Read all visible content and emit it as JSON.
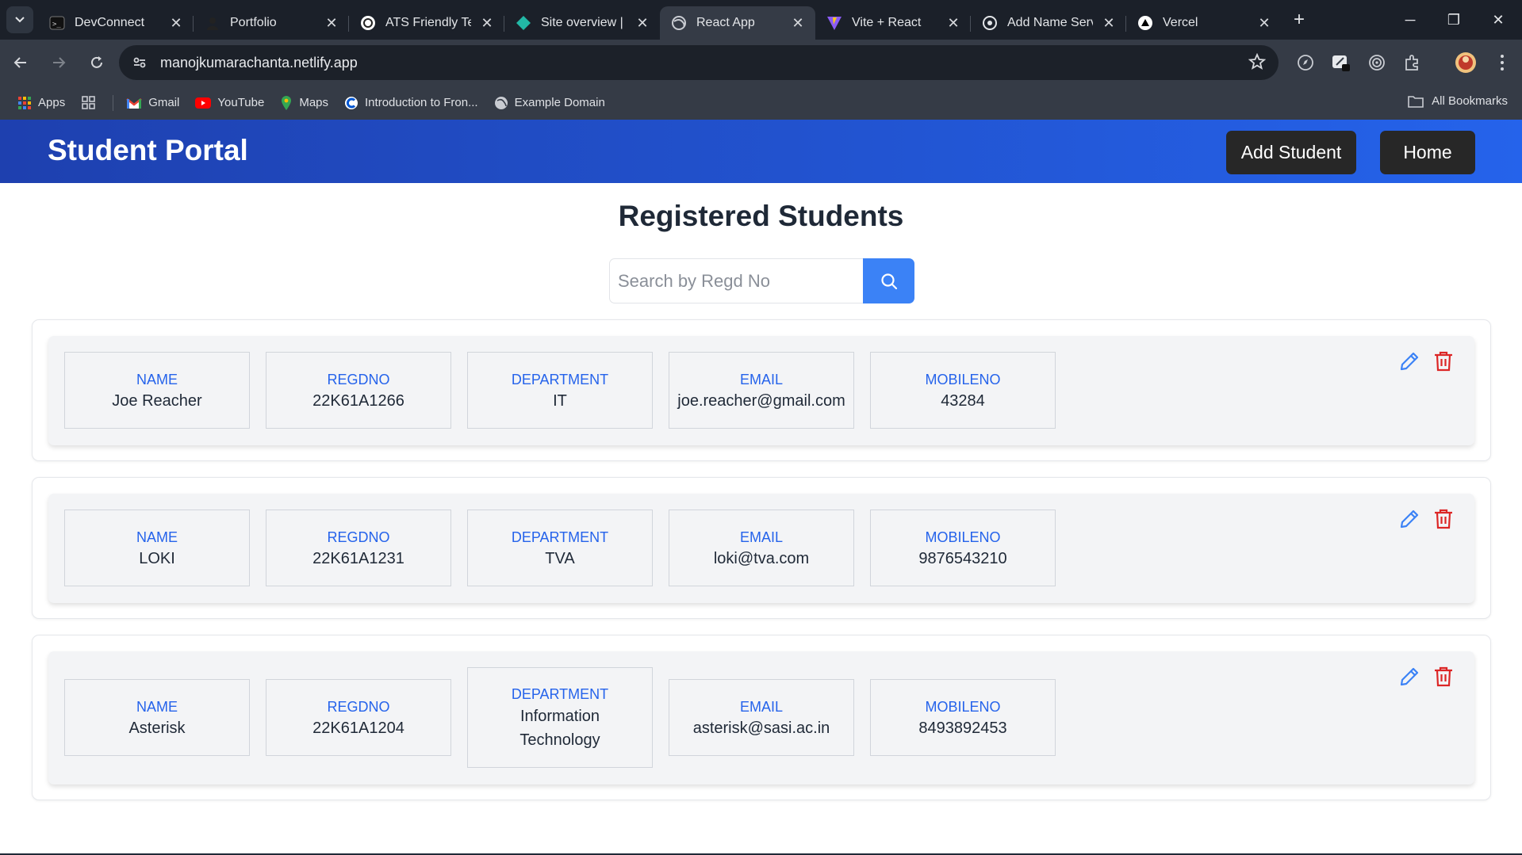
{
  "browser": {
    "tabs": [
      {
        "title": "DevConnect",
        "icon": "devconnect-favicon"
      },
      {
        "title": "Portfolio",
        "icon": "portfolio-favicon"
      },
      {
        "title": "ATS Friendly Tech",
        "icon": "chatgpt-favicon"
      },
      {
        "title": "Site overview | m",
        "icon": "netlify-favicon"
      },
      {
        "title": "React App",
        "icon": "globe-favicon",
        "active": true
      },
      {
        "title": "Vite + React",
        "icon": "vite-favicon"
      },
      {
        "title": "Add Name Serve",
        "icon": "openai-favicon"
      },
      {
        "title": "Vercel",
        "icon": "vercel-favicon"
      }
    ],
    "url": "manojkumarachanta.netlify.app",
    "bookmarks": [
      {
        "label": "Apps",
        "icon": "apps-grid-icon"
      },
      {
        "label": "",
        "icon": "tab-groups-icon"
      },
      {
        "label": "Gmail",
        "icon": "gmail-icon"
      },
      {
        "label": "YouTube",
        "icon": "youtube-icon"
      },
      {
        "label": "Maps",
        "icon": "maps-icon"
      },
      {
        "label": "Introduction to Fron...",
        "icon": "coursera-icon"
      },
      {
        "label": "Example Domain",
        "icon": "globe-icon"
      }
    ],
    "all_bookmarks": "All Bookmarks"
  },
  "app": {
    "brand": "Student Portal",
    "nav": {
      "add_student": "Add Student",
      "home": "Home"
    },
    "page_title": "Registered Students",
    "search": {
      "placeholder": "Search by Regd No",
      "value": ""
    },
    "students": [
      {
        "fields": [
          {
            "label": "NAME",
            "value": "Joe Reacher"
          },
          {
            "label": "REGDNO",
            "value": "22K61A1266"
          },
          {
            "label": "DEPARTMENT",
            "value": "IT"
          },
          {
            "label": "EMAIL",
            "value": "joe.reacher@gmail.com"
          },
          {
            "label": "MOBILENO",
            "value": "43284"
          }
        ]
      },
      {
        "fields": [
          {
            "label": "NAME",
            "value": "LOKI"
          },
          {
            "label": "REGDNO",
            "value": "22K61A1231"
          },
          {
            "label": "DEPARTMENT",
            "value": "TVA"
          },
          {
            "label": "EMAIL",
            "value": "loki@tva.com"
          },
          {
            "label": "MOBILENO",
            "value": "9876543210"
          }
        ]
      },
      {
        "fields": [
          {
            "label": "NAME",
            "value": "Asterisk"
          },
          {
            "label": "REGDNO",
            "value": "22K61A1204"
          },
          {
            "label": "DEPARTMENT",
            "value": "Information Technology"
          },
          {
            "label": "EMAIL",
            "value": "asterisk@sasi.ac.in"
          },
          {
            "label": "MOBILENO",
            "value": "8493892453"
          }
        ]
      }
    ]
  },
  "colors": {
    "header_start": "#1e40af",
    "header_end": "#2563eb",
    "label_blue": "#2563eb",
    "search_button": "#3b82f6",
    "edit_icon": "#3b82f6",
    "delete_icon": "#dc2626",
    "nav_button": "#272727"
  }
}
